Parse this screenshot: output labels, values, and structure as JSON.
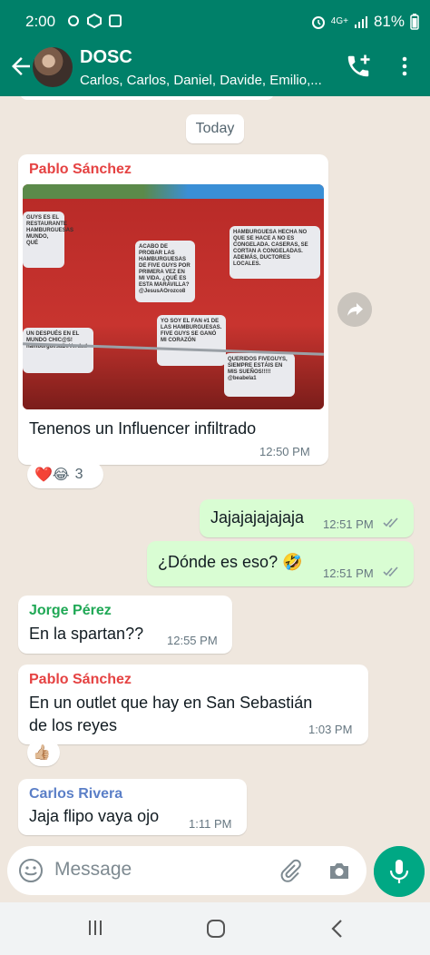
{
  "status_bar": {
    "time": "2:00",
    "network": "4G+",
    "battery": "81%"
  },
  "header": {
    "group_name": "DOSC",
    "members": "Carlos, Carlos, Daniel, Davide, Emilio,...",
    "icons": [
      "back-arrow-icon",
      "add-call-icon",
      "more-vert-icon"
    ]
  },
  "chat": {
    "date_chip": "Today",
    "messages": [
      {
        "sender": "Pablo Sánchez",
        "sender_color": "#e54242",
        "has_image": true,
        "image_cards": [
          "GUYS ES EL RESTAURANTE HAMBURGUESAS MUNDO, QUÉ",
          "ACABO DE PROBAR LAS HAMBURGUESAS DE FIVE GUYS POR PRIMERA VEZ EN MI VIDA. ¿QUÉ ES ESTA MARAVILLA? @JesusAOrozco8",
          "HAMBURGUESA HECHA NO QUE SE HACE A NO ES CONGELADA. CASERAS, SE CORTAN A CONGELADAS. ADEMÁS, DUCTORES LOCALES.",
          "YO SOY EL FAN #1 DE LAS HAMBURGUESAS. FIVE GUYS SE GANÓ MI CORAZÓN",
          "UN DESPUÉS EN EL MUNDO CHIC@S! hamburguesaDeVerdad",
          "QUERIDOS FIVEGUYS, SIEMPRE ESTÁIS EN MIS SUEÑOS!!!!! @beabela1"
        ],
        "text": "Tenenos un Influencer infiltrado",
        "time": "12:50 PM",
        "reactions": {
          "emojis": "❤️😂",
          "count": "3"
        }
      },
      {
        "outgoing": true,
        "text": "Jajajajajajaja",
        "time": "12:51 PM"
      },
      {
        "outgoing": true,
        "text": "¿Dónde es eso? 🤣",
        "time": "12:51 PM"
      },
      {
        "sender": "Jorge Pérez",
        "sender_color": "#1fa855",
        "text": "En la spartan??",
        "time": "12:55 PM"
      },
      {
        "sender": "Pablo Sánchez",
        "sender_color": "#e54242",
        "text_line1": "En un outlet que hay en San Sebastián",
        "text_line2": "de los reyes",
        "time": "1:03 PM",
        "reaction": "👍🏼"
      },
      {
        "sender": "Carlos Rivera",
        "sender_color": "#5b7fc7",
        "text": "Jaja flipo vaya ojo",
        "time": "1:11 PM"
      }
    ]
  },
  "input": {
    "placeholder": "Message"
  },
  "colors": {
    "header": "#008069",
    "outgoing_bubble": "#d9fdd3",
    "mic": "#00a884",
    "wallpaper": "#efe7de"
  }
}
